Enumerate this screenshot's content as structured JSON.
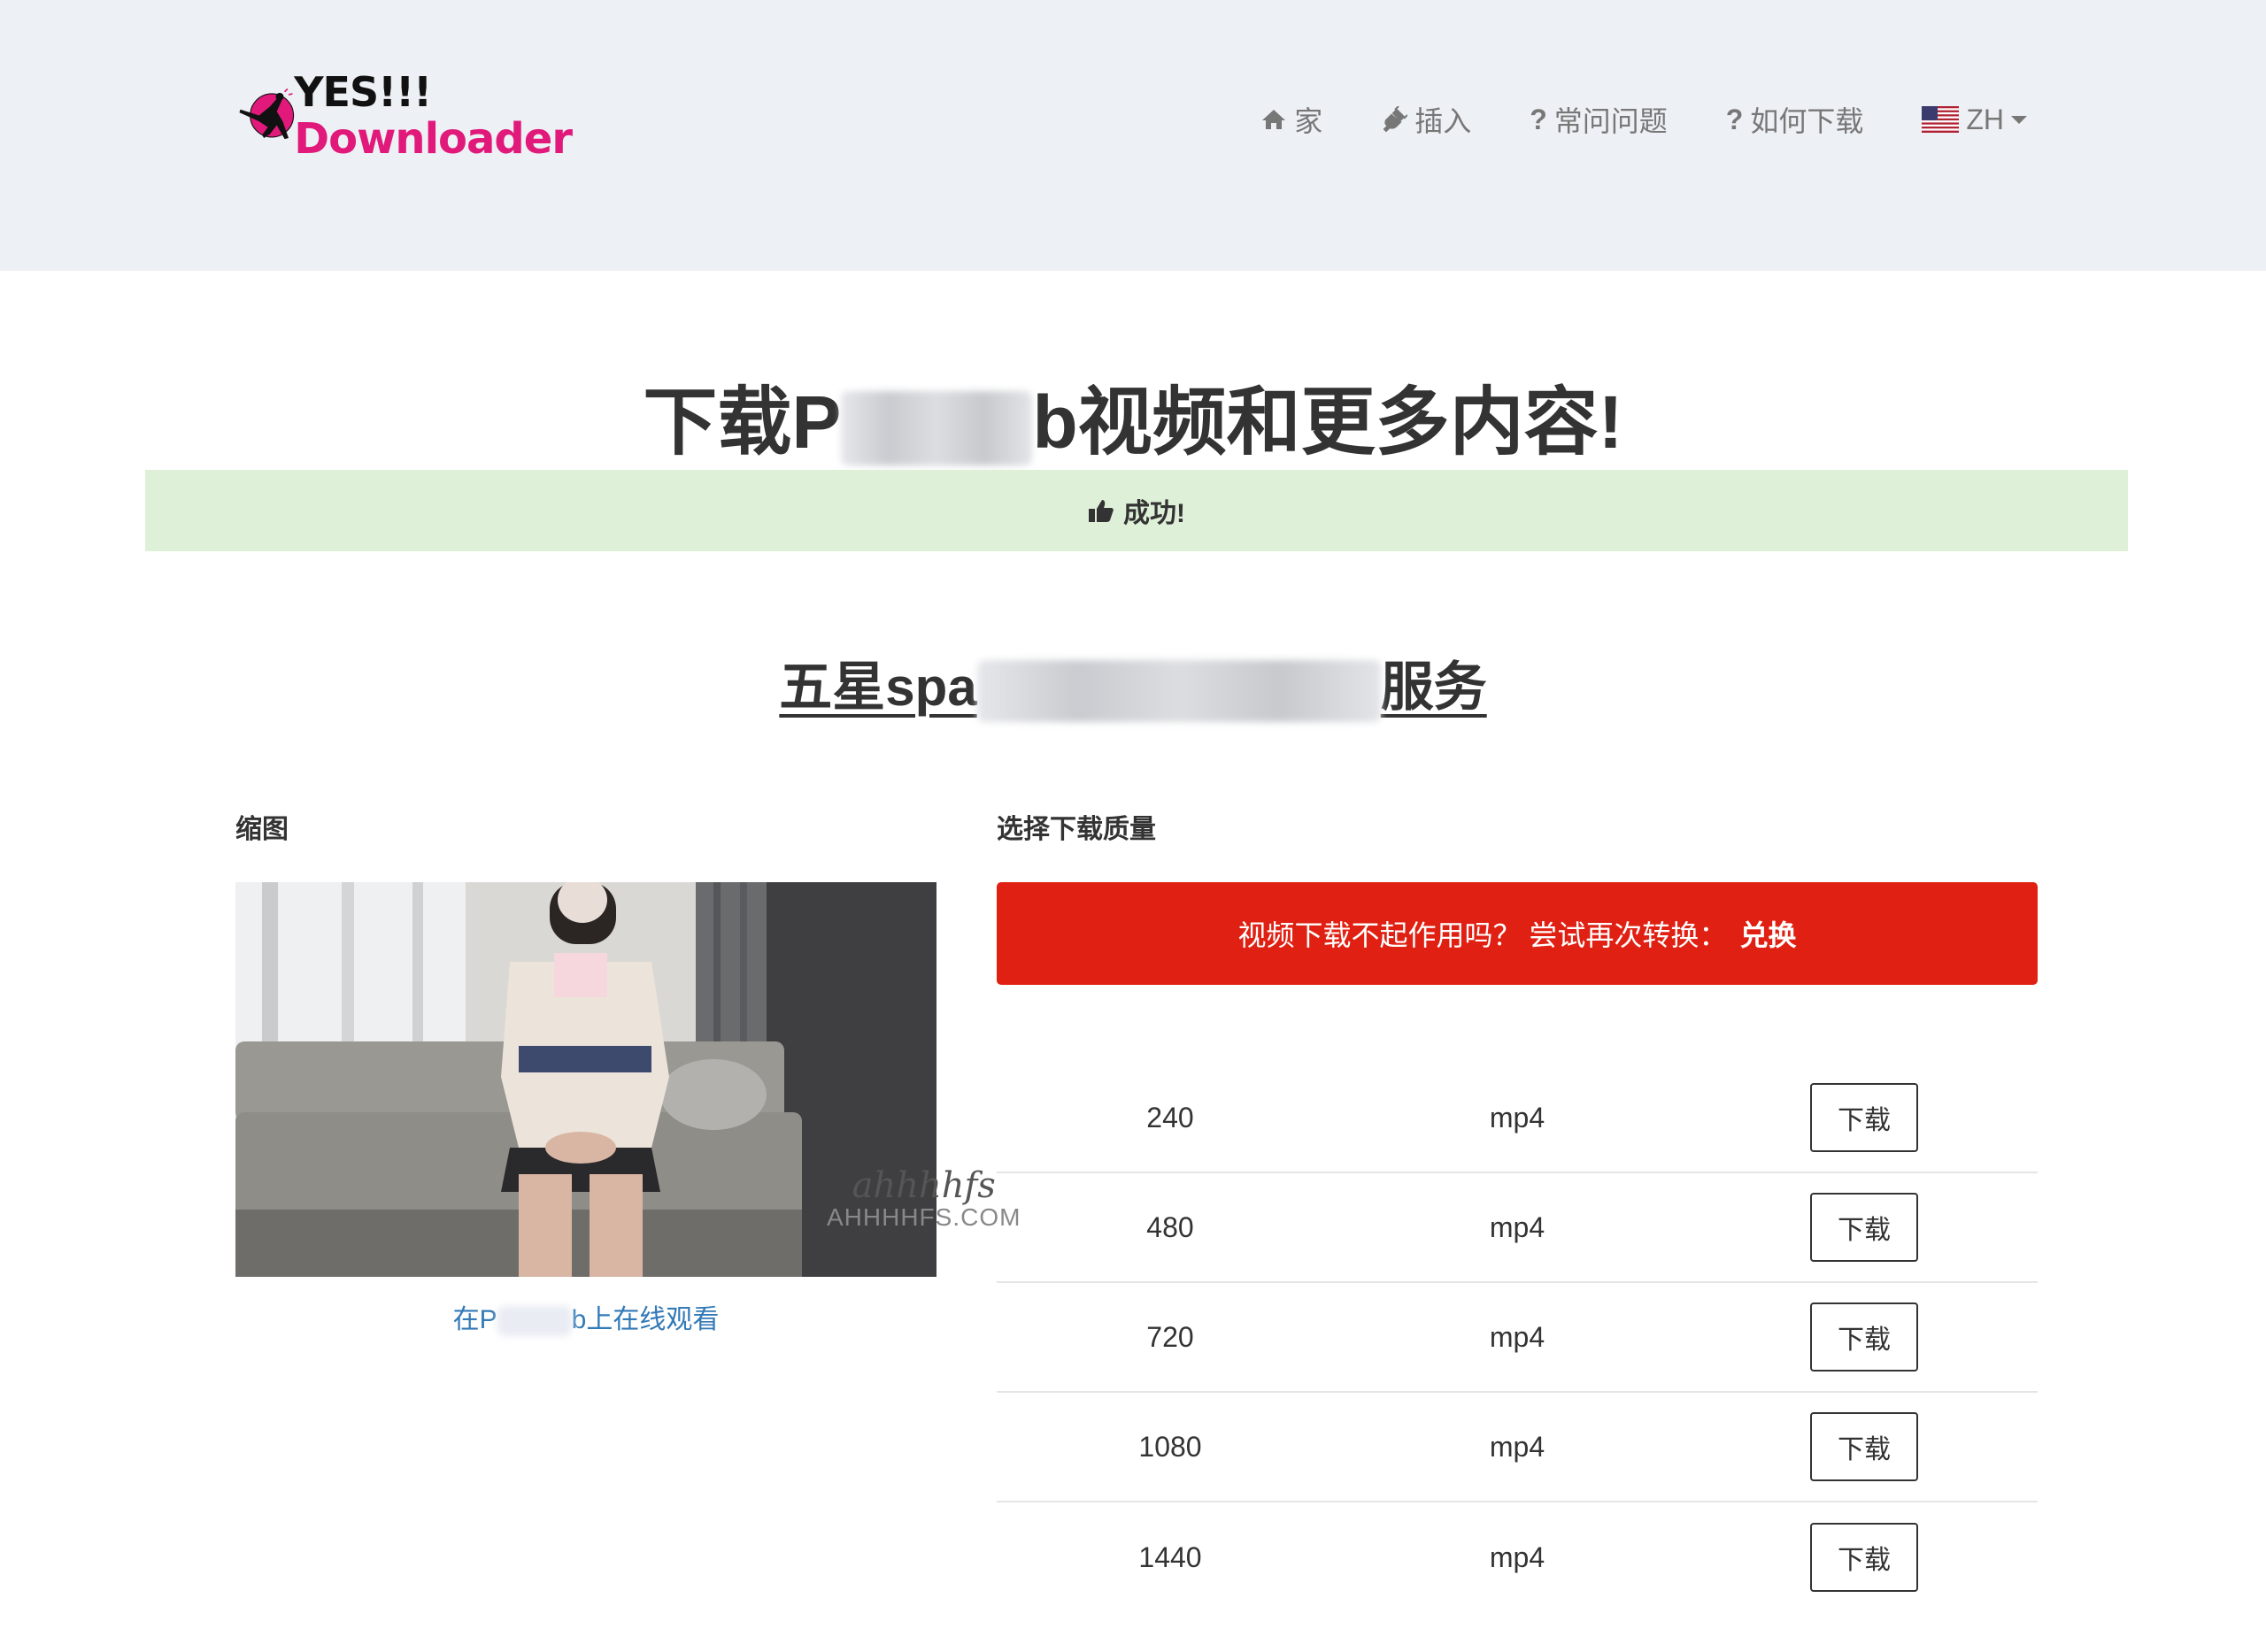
{
  "header": {
    "logo": {
      "line1": "YES!!!",
      "line2": "Downloader",
      "brand_color": "#e0197a"
    },
    "nav": [
      {
        "icon": "home-icon",
        "label": "家"
      },
      {
        "icon": "plug-icon",
        "label": "插入"
      },
      {
        "icon": "question-icon",
        "label": "常问问题"
      },
      {
        "icon": "question-icon",
        "label": "如何下载"
      }
    ],
    "language": {
      "icon": "us-flag-icon",
      "label": "ZH"
    }
  },
  "main": {
    "title": {
      "before": "下载P",
      "after": "b视频和更多内容!"
    },
    "success_message": "成功!",
    "video_title": {
      "before": "五星spa",
      "after": "服务"
    },
    "thumbnail_label": "缩图",
    "quality_label": "选择下载质量",
    "watch_link": {
      "before": "在P",
      "after": "b上在线观看"
    },
    "watermark": {
      "script": "ahhhhfs",
      "domain": "AHHHHFS.COM"
    },
    "retry": {
      "message": "视频下载不起作用吗？ 尝试再次转换：",
      "convert_label": "兑换",
      "color": "#e02012"
    },
    "downloads": [
      {
        "quality": "240",
        "format": "mp4",
        "button": "下载"
      },
      {
        "quality": "480",
        "format": "mp4",
        "button": "下载"
      },
      {
        "quality": "720",
        "format": "mp4",
        "button": "下载"
      },
      {
        "quality": "1080",
        "format": "mp4",
        "button": "下载"
      },
      {
        "quality": "1440",
        "format": "mp4",
        "button": "下载"
      }
    ]
  },
  "colors": {
    "header_bg": "#edf0f4",
    "success_bg": "#dff0d8",
    "link": "#337ab7"
  }
}
